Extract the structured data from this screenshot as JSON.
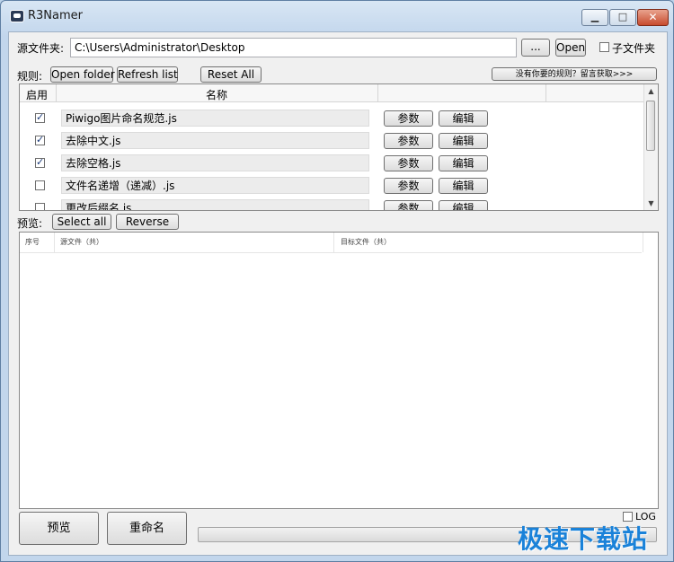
{
  "window": {
    "title": "R3Namer"
  },
  "source": {
    "label": "源文件夹:",
    "path": "C:\\Users\\Administrator\\Desktop",
    "browse_label": "...",
    "open_label": "Open",
    "subfolder_label": "子文件夹",
    "subfolder_checked": false
  },
  "rules": {
    "label": "规则:",
    "open_folder_label": "Open folder",
    "refresh_label": "Refresh list",
    "reset_label": "Reset All",
    "get_more_label": "没有你要的规则？留言获取>>>",
    "columns": {
      "enabled": "启用",
      "name": "名称"
    },
    "items": [
      {
        "enabled": true,
        "name": "Piwigo图片命名规范.js",
        "param_label": "参数",
        "edit_label": "编辑"
      },
      {
        "enabled": true,
        "name": "去除中文.js",
        "param_label": "参数",
        "edit_label": "编辑"
      },
      {
        "enabled": true,
        "name": "去除空格.js",
        "param_label": "参数",
        "edit_label": "编辑"
      },
      {
        "enabled": false,
        "name": "文件名递增（递减）.js",
        "param_label": "参数",
        "edit_label": "编辑"
      },
      {
        "enabled": false,
        "name": "更改后缀名.js",
        "param_label": "参数",
        "edit_label": "编辑"
      }
    ]
  },
  "preview": {
    "label": "预览:",
    "select_all_label": "Select all",
    "reverse_label": "Reverse",
    "columns": {
      "index": "序号",
      "source": "源文件（共）",
      "target": "目标文件（共）"
    }
  },
  "footer": {
    "preview_button": "预览",
    "rename_button": "重命名",
    "log_label": "LOG",
    "log_checked": false,
    "progress": 0,
    "watermark": "极速下载站"
  },
  "colors": {
    "watermark": "#1a82d9",
    "close_button": "#c74b2e"
  }
}
